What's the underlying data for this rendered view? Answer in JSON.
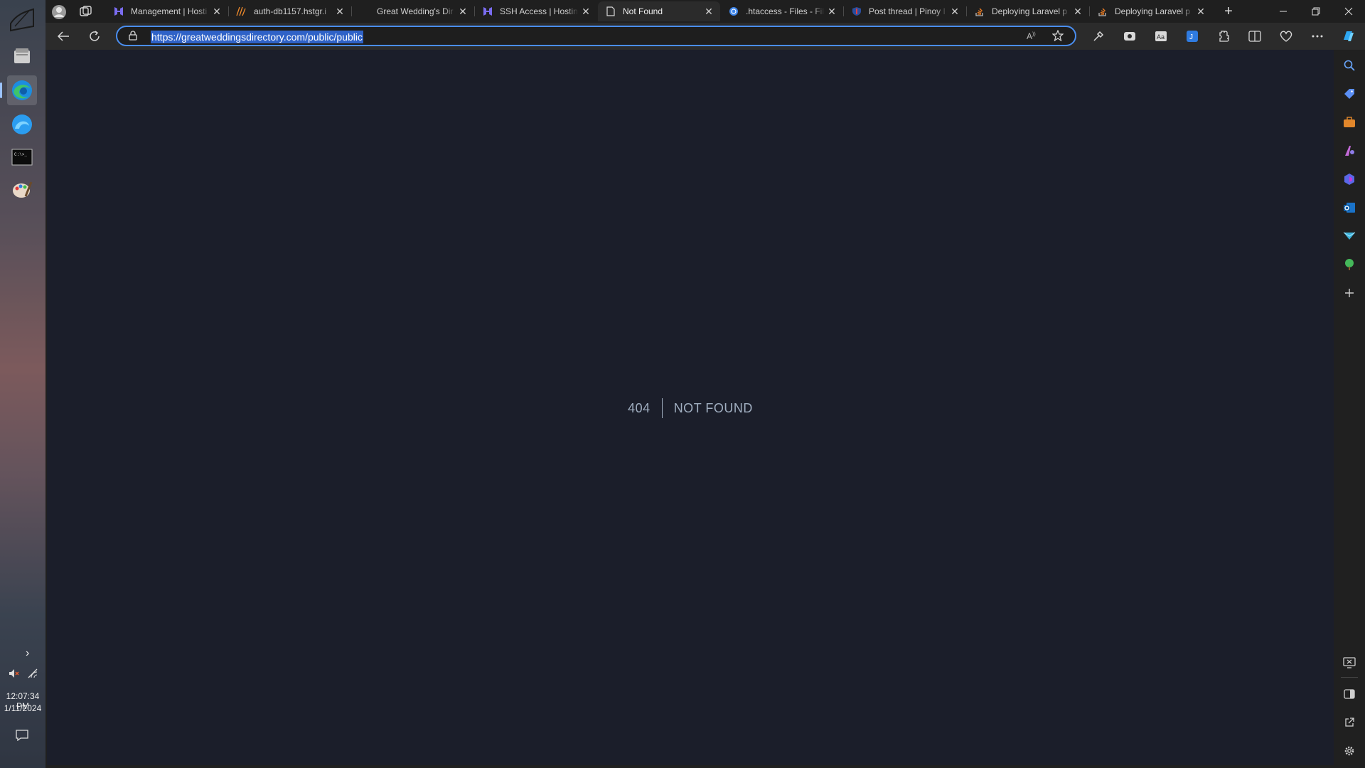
{
  "taskbar": {
    "icons": [
      "start-flag-icon",
      "file-explorer-icon",
      "edge-browser-icon",
      "edge-alt-icon",
      "terminal-icon",
      "paint-icon"
    ],
    "time": "12:07:34 PM",
    "date": "1/11/2024",
    "expand_icon": "chevron-right-icon"
  },
  "browser": {
    "tabs": [
      {
        "title": "Management | Hosti",
        "icon": "hostinger-icon",
        "active": false
      },
      {
        "title": "auth-db1157.hstgr.i",
        "icon": "phpmyadmin-icon",
        "active": false
      },
      {
        "title": "Great Wedding's Dir",
        "icon": "blank-icon",
        "active": false
      },
      {
        "title": "SSH Access | Hostin",
        "icon": "hostinger-icon",
        "active": false
      },
      {
        "title": "Not Found",
        "icon": "page-icon",
        "active": true
      },
      {
        "title": ".htaccess - Files - Fil",
        "icon": "globe-icon",
        "active": false
      },
      {
        "title": "Post thread | Pinoy I",
        "icon": "shield-icon",
        "active": false
      },
      {
        "title": "Deploying Laravel p",
        "icon": "stackoverflow-icon",
        "active": false
      },
      {
        "title": "Deploying Laravel p",
        "icon": "stackoverflow-icon",
        "active": false
      }
    ],
    "new_tab_label": "+",
    "address": {
      "url": "https://greatweddingsdirectory.com/public/public"
    }
  },
  "page": {
    "code": "404",
    "message": "NOT FOUND"
  },
  "colors": {
    "page_bg": "#1b1e2a",
    "text": "#a0aec0",
    "accent": "#4a8ef0"
  }
}
